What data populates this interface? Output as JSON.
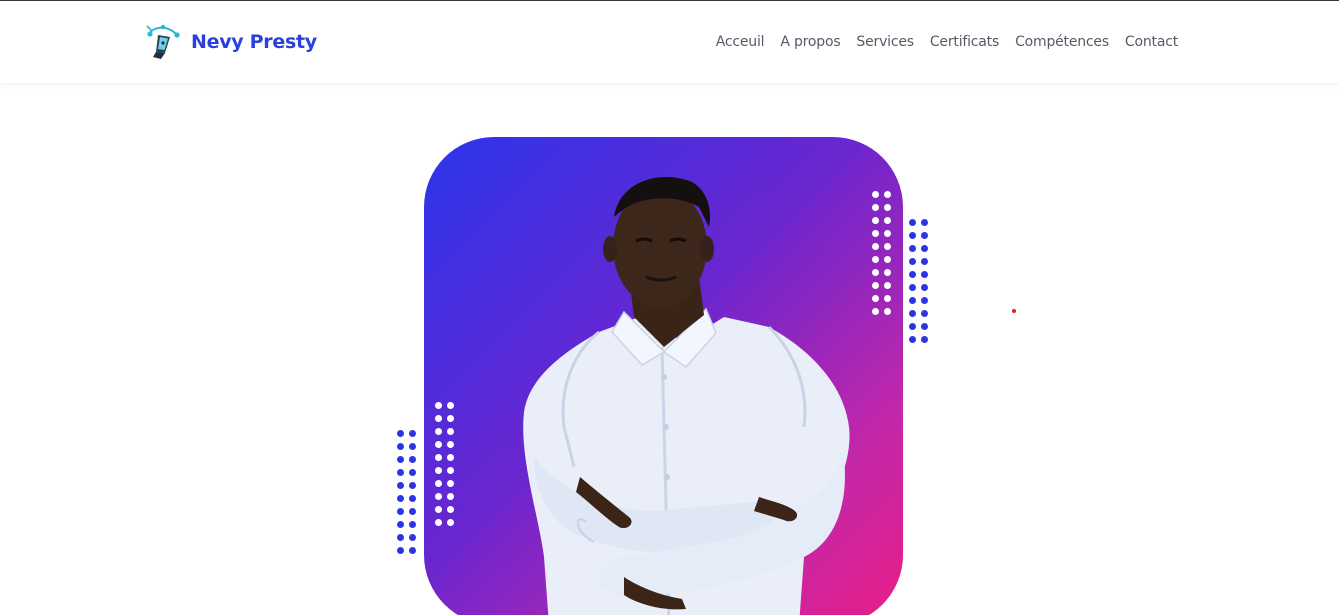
{
  "brand": {
    "name": "Nevy Presty",
    "logo_icon": "pen-nib-logo-icon",
    "color": "#2a3fe0"
  },
  "nav": {
    "items": [
      {
        "label": "Acceuil"
      },
      {
        "label": "A propos"
      },
      {
        "label": "Services"
      },
      {
        "label": "Certificats"
      },
      {
        "label": "Compétences"
      },
      {
        "label": "Contact"
      }
    ],
    "color": "#555b66"
  },
  "hero": {
    "portrait_alt": "Portrait of a man in a white shirt with arms crossed",
    "gradient_colors": [
      "#2b35ec",
      "#6a26cf",
      "#c427a8",
      "#e81e85"
    ],
    "dot_accent_color": "#2a35e6"
  }
}
